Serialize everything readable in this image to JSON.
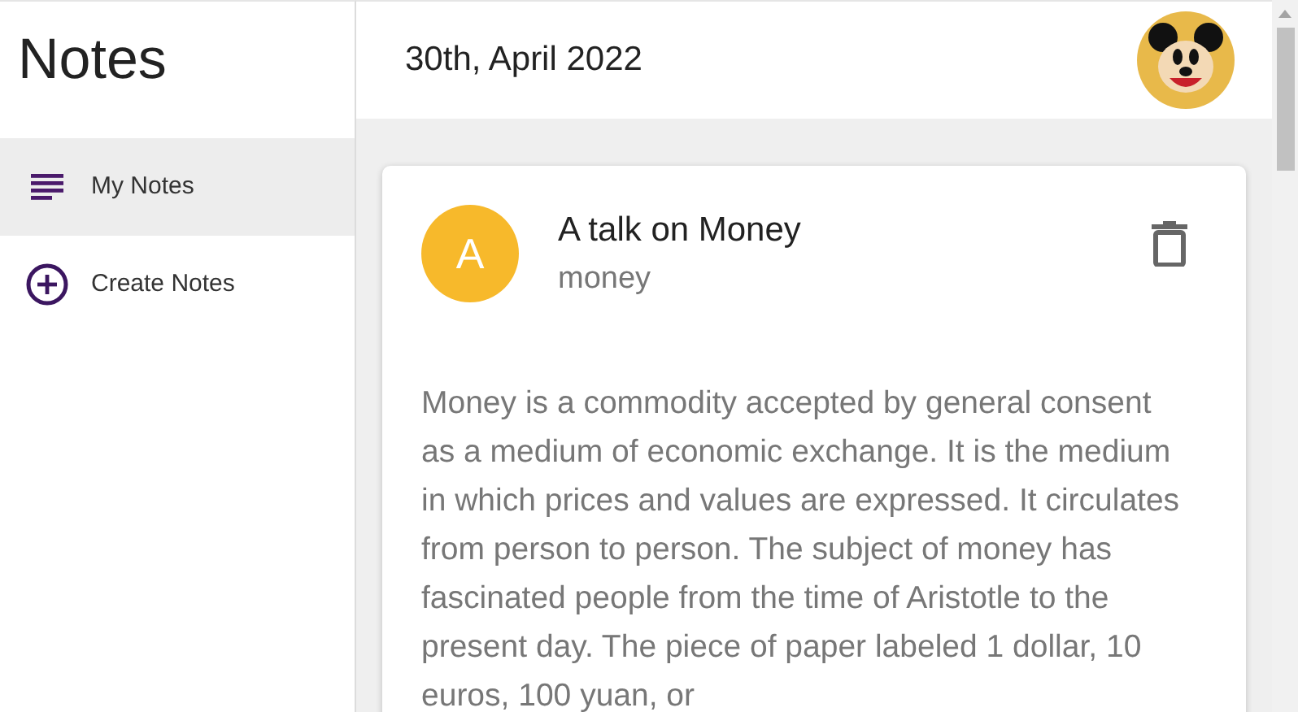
{
  "sidebar": {
    "title": "Notes",
    "items": [
      {
        "label": "My Notes",
        "kind": "list",
        "selected": true
      },
      {
        "label": "Create Notes",
        "kind": "add",
        "selected": false
      }
    ]
  },
  "header": {
    "date": "30th, April 2022"
  },
  "notes": [
    {
      "initial": "A",
      "title": "A talk on Money",
      "category": "money",
      "body": "Money is a commodity accepted by general consent as a medium of economic exchange. It is the medium in which prices and values are expressed. It circulates from person to person. The subject of money has fascinated people from the time of Aristotle to the present day. The piece of paper labeled 1 dollar, 10 euros, 100 yuan, or"
    }
  ]
}
